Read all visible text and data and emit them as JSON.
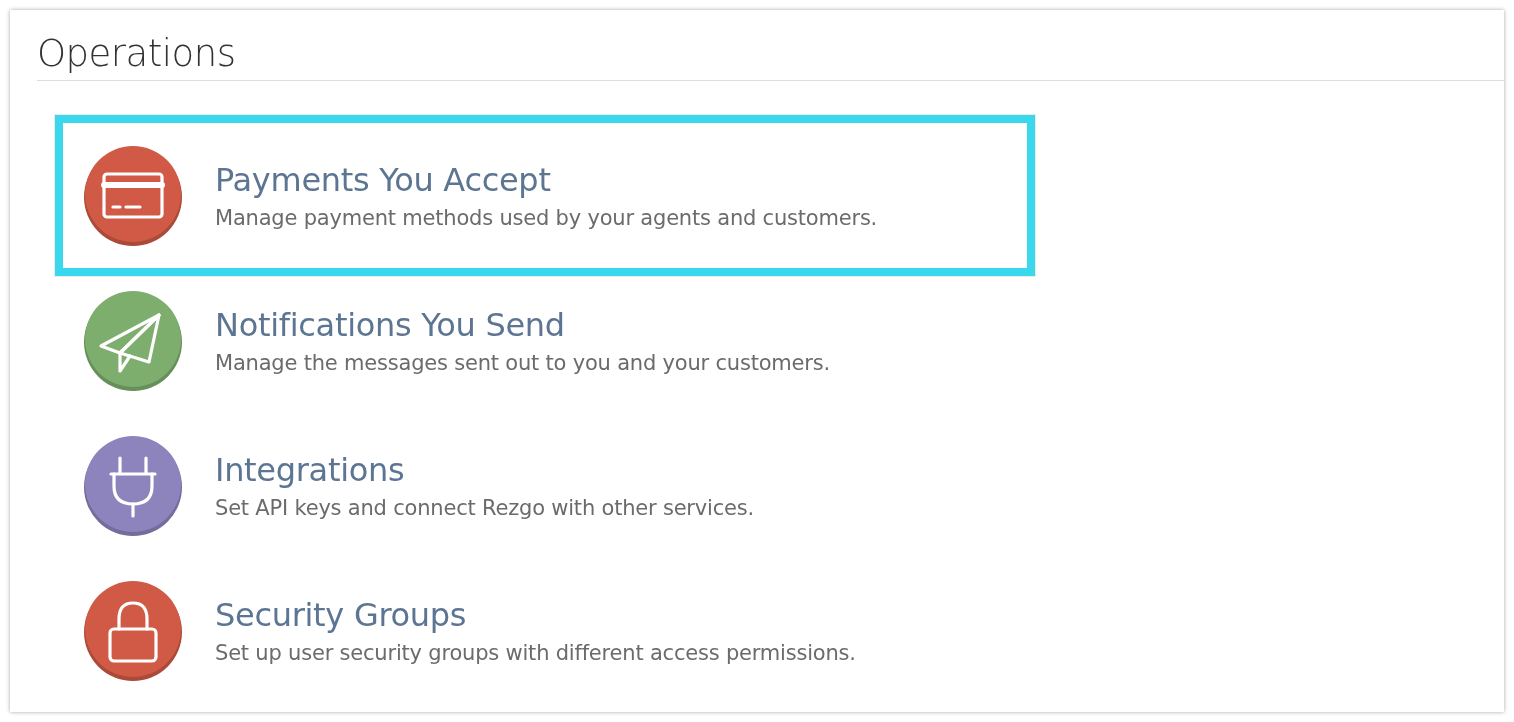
{
  "heading": "Operations",
  "items": [
    {
      "kind": "card",
      "color": "#d05a45",
      "title": "Payments You Accept",
      "description": "Manage payment methods used by your agents and customers.",
      "highlighted": true
    },
    {
      "kind": "plane",
      "color": "#7eae6e",
      "title": "Notifications You Send",
      "description": "Manage the messages sent out to you and your customers.",
      "highlighted": false
    },
    {
      "kind": "plug",
      "color": "#8e84bd",
      "title": "Integrations",
      "description": "Set API keys and connect Rezgo with other services.",
      "highlighted": false
    },
    {
      "kind": "lock",
      "color": "#d05a45",
      "title": "Security Groups",
      "description": "Set up user security groups with different access permissions.",
      "highlighted": false
    }
  ]
}
